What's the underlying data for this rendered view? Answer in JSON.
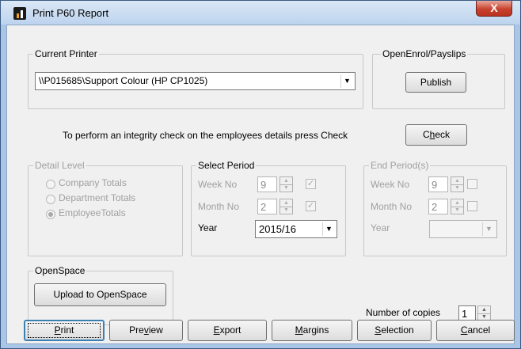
{
  "window": {
    "title": "Print P60 Report",
    "close_glyph": "X"
  },
  "current_printer": {
    "label": "Current Printer",
    "selected": "\\\\P015685\\Support Colour (HP CP1025)"
  },
  "openenrol": {
    "label": "OpenEnrol/Payslips",
    "publish_label": "Publish"
  },
  "integrity": {
    "message": "To perform an integrity check on the employees details press Check",
    "check_label_pre": "C",
    "check_label_u": "h",
    "check_label_post": "eck"
  },
  "detail_level": {
    "label": "Detail Level",
    "options": [
      {
        "label": "Company Totals",
        "checked": false
      },
      {
        "label": "Department Totals",
        "checked": false
      },
      {
        "label": "EmployeeTotals",
        "checked": true
      }
    ]
  },
  "select_period": {
    "label": "Select Period",
    "week_label": "Week No",
    "week_value": "9",
    "week_checked": true,
    "month_label": "Month No",
    "month_value": "2",
    "month_checked": true,
    "year_label": "Year",
    "year_value": "2015/16"
  },
  "end_period": {
    "label": "End Period(s)",
    "week_label": "Week No",
    "week_value": "9",
    "week_checked": false,
    "month_label": "Month No",
    "month_value": "2",
    "month_checked": false,
    "year_label": "Year",
    "year_value": ""
  },
  "openspace": {
    "label": "OpenSpace",
    "upload_label": "Upload to OpenSpace"
  },
  "copies": {
    "label": "Number of copies",
    "value": "1"
  },
  "buttons": {
    "print": {
      "u": "P",
      "rest": "rint"
    },
    "preview": {
      "pre": "Pre",
      "u": "v",
      "rest": "iew"
    },
    "export": {
      "u": "E",
      "rest": "xport"
    },
    "margins": {
      "u": "M",
      "rest": "argins"
    },
    "selection": {
      "u": "S",
      "rest": "election"
    },
    "cancel": {
      "u": "C",
      "rest": "ancel"
    }
  },
  "glyphs": {
    "dropdown": "▼",
    "spin_up": "▲",
    "spin_down": "▼",
    "check": "✓"
  },
  "colors": {
    "accent": "#3c7fb1",
    "close": "#c8432f"
  }
}
